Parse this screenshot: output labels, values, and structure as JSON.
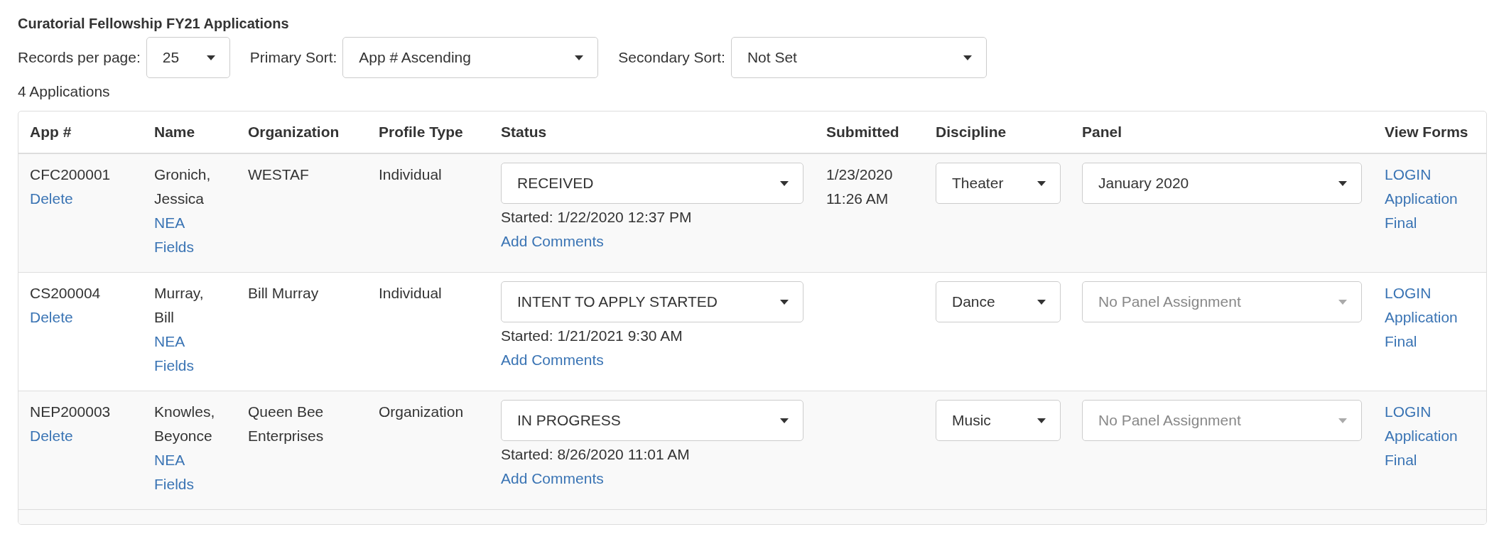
{
  "title": "Curatorial Fellowship FY21 Applications",
  "controls": [
    {
      "label": "Records per page:",
      "value": "25",
      "kind": "small"
    },
    {
      "label": "Primary Sort:",
      "value": "App # Ascending",
      "kind": "wide"
    },
    {
      "label": "Secondary Sort:",
      "value": "Not Set",
      "kind": "wide"
    }
  ],
  "count": "4 Applications",
  "table": {
    "columns": [
      "App #",
      "Name",
      "Organization",
      "Profile Type",
      "Status",
      "Submitted",
      "Discipline",
      "Panel",
      "View Forms"
    ],
    "rows": [
      {
        "app_no": "CFC200001",
        "delete_link": "Delete",
        "name": "Gronich, Jessica",
        "nea_link": "NEA Fields",
        "organization": "WESTAF",
        "profile_type": "Individual",
        "status": "RECEIVED",
        "started": "Started: 1/22/2020 12:37 PM",
        "comments_link": "Add Comments",
        "submitted": "1/23/2020 11:26 AM",
        "discipline": "Theater",
        "panel": {
          "value": "January 2020",
          "disabled": false
        },
        "links": [
          "LOGIN",
          "Application",
          "Final"
        ]
      },
      {
        "app_no": "CS200004",
        "delete_link": "Delete",
        "name": "Murray, Bill",
        "nea_link": "NEA Fields",
        "organization": "Bill Murray",
        "profile_type": "Individual",
        "status": "INTENT TO APPLY STARTED",
        "started": "Started: 1/21/2021 9:30 AM",
        "comments_link": "Add Comments",
        "discipline": "Dance",
        "panel": {
          "value": "No Panel Assignment",
          "disabled": true
        },
        "links": [
          "LOGIN",
          "Application",
          "Final"
        ]
      },
      {
        "app_no": "NEP200003",
        "delete_link": "Delete",
        "name": "Knowles, Beyonce",
        "nea_link": "NEA Fields",
        "organization": "Queen Bee Enterprises",
        "profile_type": "Organization",
        "status": "IN PROGRESS",
        "started": "Started: 8/26/2020 11:01 AM",
        "comments_link": "Add Comments",
        "discipline": "Music",
        "panel": {
          "value": "No Panel Assignment",
          "disabled": true
        },
        "links": [
          "LOGIN",
          "Application",
          "Final"
        ]
      }
    ]
  }
}
